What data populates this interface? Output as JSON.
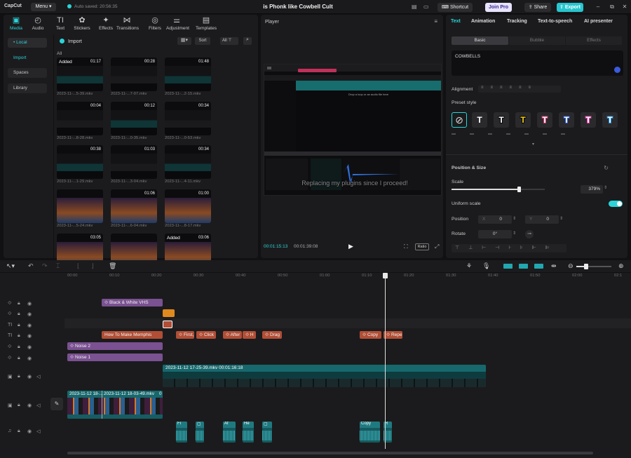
{
  "app": {
    "logo": "CapCut",
    "menu_label": "Menu",
    "autosave": "Auto saved: 20:56:35",
    "project_title": "is Phonk like Cowbell Cult",
    "shortcut_label": "Shortcut",
    "join_pro_label": "Join Pro",
    "share_label": "Share",
    "export_label": "Export"
  },
  "media": {
    "tools": [
      {
        "label": "Media",
        "icon": "▣"
      },
      {
        "label": "Audio",
        "icon": "◴"
      },
      {
        "label": "Text",
        "icon": "TI"
      },
      {
        "label": "Stickers",
        "icon": "✿"
      },
      {
        "label": "Effects",
        "icon": "✦"
      },
      {
        "label": "Transitions",
        "icon": "⋈"
      },
      {
        "label": "Filters",
        "icon": "◎"
      },
      {
        "label": "Adjustment",
        "icon": "⚌"
      },
      {
        "label": "Templates",
        "icon": "▤"
      }
    ],
    "nav": [
      "• Local",
      "Import",
      "Spaces",
      "Library"
    ],
    "import_label": "Import",
    "sort_label": "Sort",
    "all_label": "All",
    "all_filter": "All",
    "items": [
      {
        "dur": "01:17",
        "name": "2023-11-...5-39.mkv",
        "added": "Added"
      },
      {
        "dur": "00:28",
        "name": "2023-11-...7-07.mkv"
      },
      {
        "dur": "01:48",
        "name": "2023-11-...2-15.mkv"
      },
      {
        "dur": "00:04",
        "name": "2023-11-...8-28.mkv"
      },
      {
        "dur": "00:12",
        "name": "2023-11-...0-35.mkv"
      },
      {
        "dur": "00:34",
        "name": "2023-11-...0-53.mkv"
      },
      {
        "dur": "00:38",
        "name": "2023-11-...1-29.mkv"
      },
      {
        "dur": "01:03",
        "name": "2023-11-...3-04.mkv"
      },
      {
        "dur": "00:34",
        "name": "2023-11-...4-11.mkv"
      },
      {
        "dur": "",
        "name": "2023-11-...5-24.mkv"
      },
      {
        "dur": "01:06",
        "name": "2023-11-...6-04.mkv"
      },
      {
        "dur": "01:00",
        "name": "2023-11-...8-17.mkv"
      },
      {
        "dur": "03:05",
        "name": ""
      },
      {
        "dur": "",
        "name": ""
      },
      {
        "dur": "03:06",
        "name": "",
        "added": "Added"
      }
    ]
  },
  "player": {
    "title": "Player",
    "current": "00:01:15:13",
    "total": "00:01:39:08",
    "ratio_label": "Ratio",
    "caption": "Replacing my plugins since I proceed!",
    "inner_text": "Drop a loop or an audio file here"
  },
  "props": {
    "tabs": [
      "Text",
      "Animation",
      "Tracking",
      "Text-to-speech",
      "AI presenter"
    ],
    "segments": [
      "Basic",
      "Bubble",
      "Effects"
    ],
    "text_value": "COWBELLS",
    "alignment_label": "Alignment",
    "preset_label": "Preset style",
    "position_size_label": "Position & Size",
    "scale_label": "Scale",
    "scale_value": "379%",
    "scale_fraction": 0.72,
    "uniform_label": "Uniform scale",
    "position_label": "Position",
    "pos_x": "0",
    "pos_y": "0",
    "x_label": "X",
    "y_label": "Y",
    "rotate_label": "Rotate",
    "rotate_value": "0°",
    "presets": [
      {
        "c": "#ffffff",
        "s": "none"
      },
      {
        "c": "#ffffff",
        "s": "#000"
      },
      {
        "c": "#f7d21c",
        "s": "#000"
      },
      {
        "c": "#ffffff",
        "s": "#d9346b"
      },
      {
        "c": "#ffffff",
        "s": "#2a5bd7"
      },
      {
        "c": "#ffffff",
        "s": "#e63fa6"
      },
      {
        "c": "#ffffff",
        "s": "#1b8fe0"
      }
    ]
  },
  "timeline": {
    "ruler": [
      "00:00",
      "00:10",
      "00:20",
      "00:30",
      "00:40",
      "00:50",
      "01:00",
      "01:10",
      "01:20",
      "01:30",
      "01:40",
      "01:50",
      "02:00",
      "02:1"
    ],
    "text_clips": {
      "vhs": "Black & White VHS",
      "memphis": "How To Make Memphis",
      "first": "First,",
      "click": "Click",
      "after": "After",
      "drag": "Drag",
      "copy": "Copy",
      "repe": "Repe"
    },
    "audio_clips": {
      "noise2": "Noise 2",
      "noise1": "Noise 1"
    },
    "video_clip": "2023-11-12 17-25-39.mkv  00:01:16:18",
    "main_clips": [
      "2023-11-12 18-...",
      "2023-11-12 18-03-49.mkv",
      "0"
    ],
    "audio_labels": [
      "Fi",
      "Af",
      "He",
      "Copy",
      "R"
    ]
  }
}
